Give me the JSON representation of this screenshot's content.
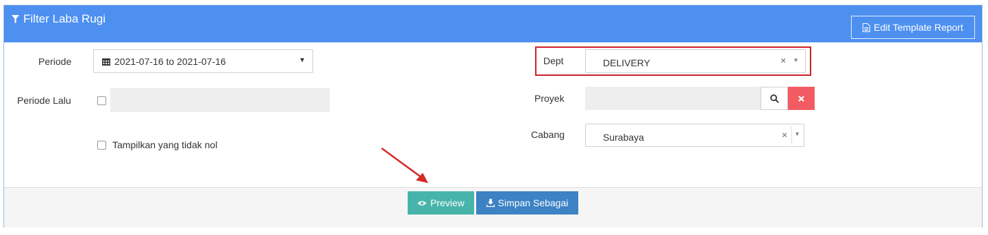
{
  "panel": {
    "title": "Filter Laba Rugi",
    "edit_template_label": "Edit Template Report"
  },
  "filters": {
    "periode_label": "Periode",
    "periode_value": "2021-07-16 to 2021-07-16",
    "periode_lalu_label": "Periode Lalu",
    "tampilkan_label": "Tampilkan yang tidak nol",
    "dept_label": "Dept",
    "dept_value": "DELIVERY",
    "proyek_label": "Proyek",
    "proyek_value": "",
    "cabang_label": "Cabang",
    "cabang_value": "Surabaya"
  },
  "actions": {
    "preview_label": "Preview",
    "simpan_label": "Simpan Sebagai"
  },
  "colors": {
    "header": "#4d90f0",
    "preview": "#47b4aa",
    "simpan": "#3c82c5",
    "clear_red": "#f35b63",
    "highlight": "#cc1f27"
  }
}
